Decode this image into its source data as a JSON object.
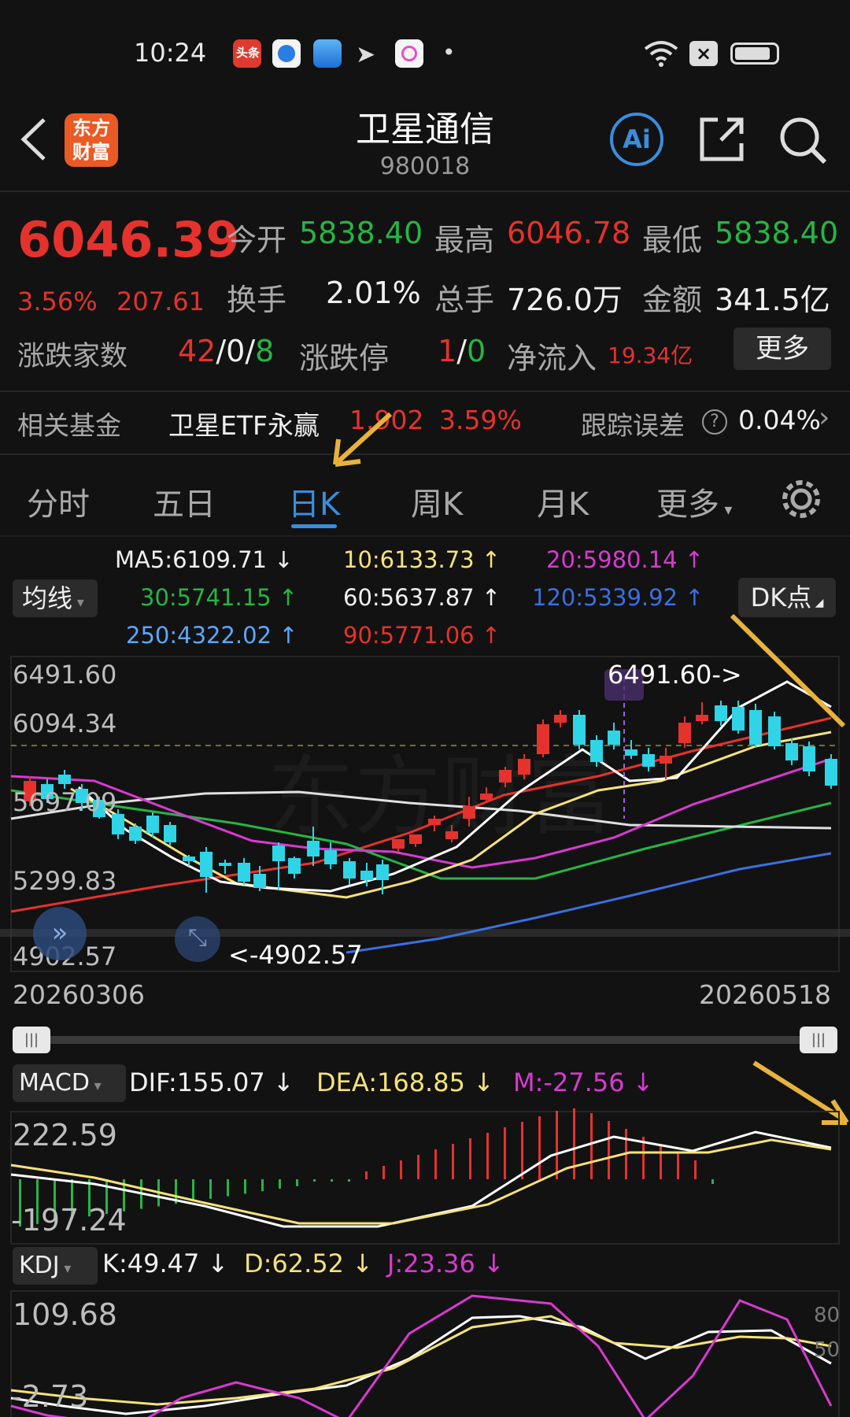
{
  "status_bar": {
    "time": "10:24",
    "app_icons": [
      "toutiao-icon",
      "blue-app-icon",
      "photo-app-icon",
      "telegram-icon",
      "colorful-app-icon"
    ],
    "dot": "•"
  },
  "header": {
    "title": "卫星通信",
    "code": "980018",
    "brand_logo": "东方财富"
  },
  "quote": {
    "price": "6046.39",
    "change_pct": "3.56%",
    "change_abs": "207.61",
    "open_label": "今开",
    "open": "5838.40",
    "high_label": "最高",
    "high": "6046.78",
    "low_label": "最低",
    "low": "5838.40",
    "turnover_label": "换手",
    "turnover": "2.01%",
    "volume_label": "总手",
    "volume": "726.0万",
    "amount_label": "金额",
    "amount": "341.5亿",
    "breadth_label": "涨跌家数",
    "breadth_up": "42",
    "breadth_sep1": "/",
    "breadth_flat": "0",
    "breadth_sep2": "/",
    "breadth_down": "8",
    "limit_label": "涨跌停",
    "limit_up": "1",
    "limit_sep": "/",
    "limit_down": "0",
    "inflow_label": "净流入",
    "inflow": "19.34亿",
    "more_button": "更多"
  },
  "fund": {
    "label": "相关基金",
    "name": "卫星ETF永赢",
    "price": "1.902",
    "pct": "3.59%",
    "error_label": "跟踪误差",
    "help_icon": "?",
    "error_value": "0.04%",
    "chevron": "›"
  },
  "tabs": [
    {
      "label": "分时"
    },
    {
      "label": "五日"
    },
    {
      "label": "日K",
      "active": true
    },
    {
      "label": "周K"
    },
    {
      "label": "月K"
    },
    {
      "label": "更多"
    }
  ],
  "ma_selector": "均线",
  "dk_button": "DK点",
  "ma_values": {
    "ma5": "MA5:6109.71 ↓",
    "ma10": "10:6133.73 ↑",
    "ma20": "20:5980.14 ↑",
    "ma30": "30:5741.15 ↑",
    "ma60": "60:5637.87 ↑",
    "ma120": "120:5339.92 ↑",
    "ma250": "250:4322.02 ↑",
    "ma90": "90:5771.06 ↑"
  },
  "kline_axis": {
    "y_labels": [
      "6491.60",
      "6094.34",
      "5697.09",
      "5299.83",
      "4902.57"
    ],
    "x_start": "20260306",
    "x_end": "20260518",
    "high_marker": "6491.60->",
    "low_marker": "<-4902.57",
    "watermark": "东方财富"
  },
  "macd": {
    "selector": "MACD",
    "dif": "DIF:155.07 ↓",
    "dea": "DEA:168.85 ↓",
    "m": "M:-27.56 ↓",
    "y_top": "222.59",
    "y_bottom": "-197.24"
  },
  "kdj": {
    "selector": "KDJ",
    "k": "K:49.47 ↓",
    "d": "D:62.52 ↓",
    "j": "J:23.36 ↓",
    "y_top": "109.68",
    "y_bottom": "-2.73",
    "ref_80": "80",
    "ref_50": "50"
  },
  "colors": {
    "up": "#e5322d",
    "down": "#2fd4e6",
    "ma5": "#ffffff",
    "ma10": "#f5e27b",
    "ma20": "#d83ad0",
    "ma30": "#26b544",
    "ma60": "#e0e0e0",
    "ma120": "#3b6fe0",
    "ma250": "#5aa8ff",
    "ma90": "#e5322d",
    "accent": "#3a8dde",
    "annotation_arrow": "#e8b33c"
  }
}
